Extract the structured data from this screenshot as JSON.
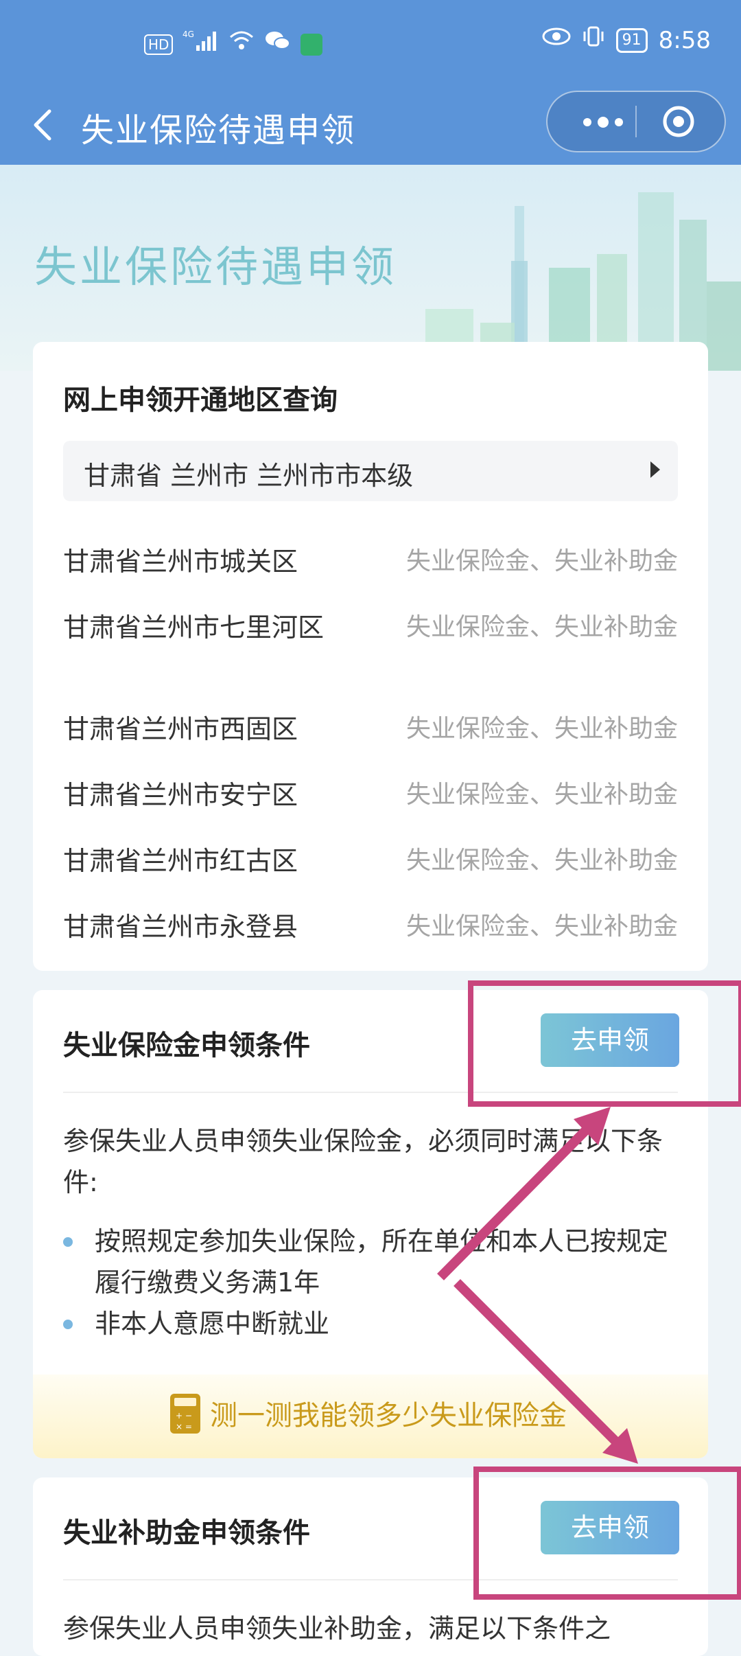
{
  "status_bar": {
    "hd": "HD",
    "signal": "4G",
    "battery": "91",
    "time": "8:58"
  },
  "nav": {
    "title": "失业保险待遇申领"
  },
  "hero": {
    "title": "失业保险待遇申领"
  },
  "region_card": {
    "title": "网上申领开通地区查询",
    "selected_region": "甘肃省 兰州市 兰州市市本级",
    "rows": [
      {
        "region": "甘肃省兰州市城关区",
        "types": "失业保险金、失业补助金"
      },
      {
        "region": "甘肃省兰州市七里河区",
        "types": "失业保险金、失业补助金"
      },
      {
        "region": "甘肃省兰州市西固区",
        "types": "失业保险金、失业补助金"
      },
      {
        "region": "甘肃省兰州市安宁区",
        "types": "失业保险金、失业补助金"
      },
      {
        "region": "甘肃省兰州市红古区",
        "types": "失业保险金、失业补助金"
      },
      {
        "region": "甘肃省兰州市永登县",
        "types": "失业保险金、失业补助金"
      }
    ]
  },
  "insurance_card": {
    "title": "失业保险金申领条件",
    "button": "去申领",
    "intro": "参保失业人员申领失业保险金，必须同时满足以下条件:",
    "bullets": [
      "按照规定参加失业保险，所在单位和本人已按规定履行缴费义务满1年",
      "非本人意愿中断就业"
    ],
    "calc_link": "测一测我能领多少失业保险金"
  },
  "subsidy_card": {
    "title": "失业补助金申领条件",
    "button": "去申领",
    "intro": "参保失业人员申领失业补助金，满足以下条件之"
  },
  "colors": {
    "nav_bg": "#5b94d9",
    "button": "#6aa6e0",
    "annotation": "#c8457d",
    "calc_text": "#c99a1b"
  }
}
